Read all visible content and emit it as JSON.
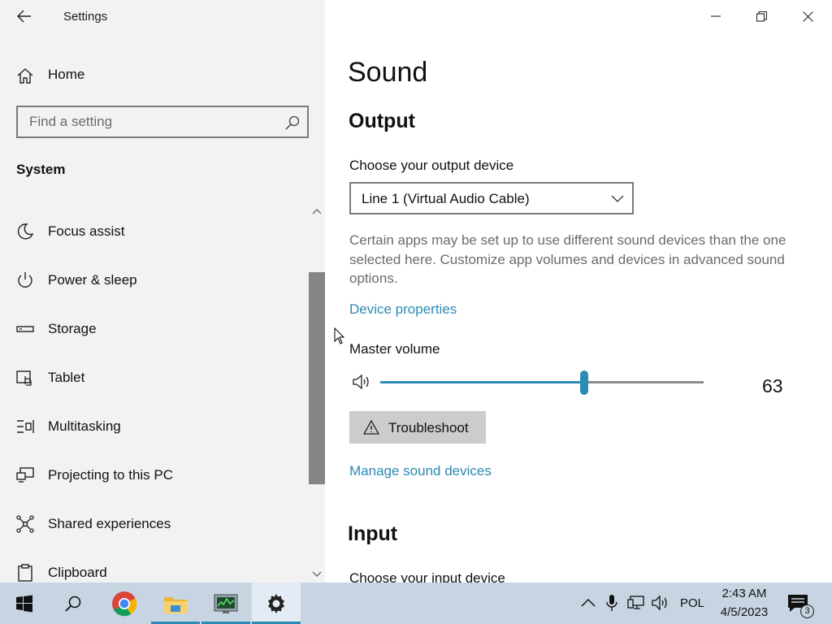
{
  "window": {
    "app_title": "Settings"
  },
  "sidebar": {
    "home_label": "Home",
    "search_placeholder": "Find a setting",
    "section_label": "System",
    "items": [
      {
        "label": "Focus assist",
        "icon": "moon-icon"
      },
      {
        "label": "Power & sleep",
        "icon": "power-icon"
      },
      {
        "label": "Storage",
        "icon": "storage-icon"
      },
      {
        "label": "Tablet",
        "icon": "tablet-icon"
      },
      {
        "label": "Multitasking",
        "icon": "multitasking-icon"
      },
      {
        "label": "Projecting to this PC",
        "icon": "projecting-icon"
      },
      {
        "label": "Shared experiences",
        "icon": "shared-experiences-icon"
      },
      {
        "label": "Clipboard",
        "icon": "clipboard-icon"
      }
    ]
  },
  "main": {
    "page_title": "Sound",
    "output": {
      "heading": "Output",
      "choose_label": "Choose your output device",
      "selected_device": "Line 1 (Virtual Audio Cable)",
      "description": "Certain apps may be set up to use different sound devices than the one selected here. Customize app volumes and devices in advanced sound options.",
      "device_properties_link": "Device properties",
      "master_volume_label": "Master volume",
      "volume_value": "63",
      "volume_level_percent": 63,
      "troubleshoot_label": "Troubleshoot",
      "manage_link": "Manage sound devices"
    },
    "input": {
      "heading": "Input",
      "choose_label": "Choose your input device"
    }
  },
  "taskbar": {
    "language": "POL",
    "time": "2:43 AM",
    "date": "4/5/2023",
    "notification_count": "3"
  },
  "colors": {
    "accent": "#2b8bb4",
    "sidebar_bg": "#f2f2f2",
    "taskbar_bg": "#c7d5e3",
    "scroll_thumb": "#858585",
    "description_text": "#6b6b6b"
  }
}
